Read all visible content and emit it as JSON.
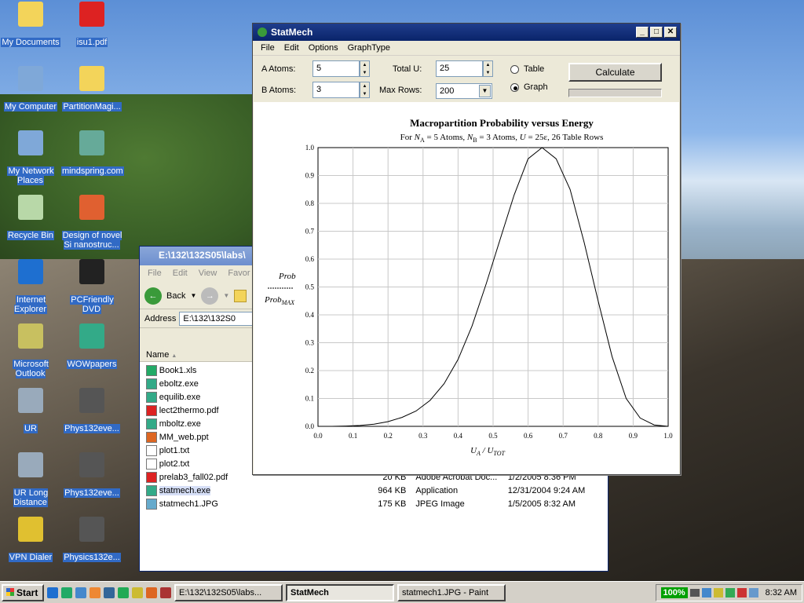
{
  "desktop": {
    "icons": [
      {
        "label": "My Documents",
        "icon": "folder-icon",
        "color": "#f3d45a"
      },
      {
        "label": "isu1.pdf",
        "icon": "pdf-icon",
        "color": "#d22"
      },
      {
        "label": "My Computer",
        "icon": "computer-icon",
        "color": "#7fa8d8"
      },
      {
        "label": "PartitionMagi...",
        "icon": "folder-zip-icon",
        "color": "#f3d45a"
      },
      {
        "label": "My Network Places",
        "icon": "network-icon",
        "color": "#7fa8d8"
      },
      {
        "label": "mindspring.com",
        "icon": "network-shortcut-icon",
        "color": "#6a9"
      },
      {
        "label": "Recycle Bin",
        "icon": "recycle-bin-icon",
        "color": "#b8d8a8"
      },
      {
        "label": "Design of novel Si nanostruc...",
        "icon": "powerpoint-icon",
        "color": "#e06030"
      },
      {
        "label": "Internet Explorer",
        "icon": "ie-icon",
        "color": "#1e6fd0"
      },
      {
        "label": "PCFriendly DVD",
        "icon": "dvd-icon",
        "color": "#222"
      },
      {
        "label": "Microsoft Outlook",
        "icon": "outlook-icon",
        "color": "#c8c060"
      },
      {
        "label": "WOWpapers",
        "icon": "wowpapers-icon",
        "color": "#3a8"
      },
      {
        "label": "UR",
        "icon": "network-drive-icon",
        "color": "#9ab"
      },
      {
        "label": "Phys132eve...",
        "icon": "document-icon",
        "color": "#555"
      },
      {
        "label": "UR Long Distance",
        "icon": "network-drive-icon",
        "color": "#9ab"
      },
      {
        "label": "Phys132eve...",
        "icon": "document-icon",
        "color": "#555"
      },
      {
        "label": "VPN Dialer",
        "icon": "vpn-icon",
        "color": "#e0c030"
      },
      {
        "label": "Physics132e...",
        "icon": "document-icon",
        "color": "#555"
      }
    ]
  },
  "explorer": {
    "title": "E:\\132\\132S05\\labs\\",
    "menu": [
      "File",
      "Edit",
      "View",
      "Favor"
    ],
    "back_label": "Back",
    "address_label": "Address",
    "address_value": "E:\\132\\132S0",
    "column_name": "Name",
    "files": [
      {
        "name": "Book1.xls",
        "size": "",
        "type": "",
        "date": ""
      },
      {
        "name": "eboltz.exe",
        "size": "",
        "type": "",
        "date": ""
      },
      {
        "name": "equilib.exe",
        "size": "",
        "type": "",
        "date": ""
      },
      {
        "name": "lect2thermo.pdf",
        "size": "",
        "type": "",
        "date": ""
      },
      {
        "name": "mboltz.exe",
        "size": "",
        "type": "",
        "date": ""
      },
      {
        "name": "MM_web.ppt",
        "size": "",
        "type": "",
        "date": ""
      },
      {
        "name": "plot1.txt",
        "size": "",
        "type": "",
        "date": ""
      },
      {
        "name": "plot2.txt",
        "size": "",
        "type": "",
        "date": ""
      },
      {
        "name": "prelab3_fall02.pdf",
        "size": "20 KB",
        "type": "Adobe Acrobat Doc...",
        "date": "1/2/2005 8:36 PM"
      },
      {
        "name": "statmech.exe",
        "size": "964 KB",
        "type": "Application",
        "date": "12/31/2004 9:24 AM"
      },
      {
        "name": "statmech1.JPG",
        "size": "175 KB",
        "type": "JPEG Image",
        "date": "1/5/2005 8:32 AM"
      }
    ]
  },
  "statmech": {
    "title": "StatMech",
    "menu": [
      "File",
      "Edit",
      "Options",
      "GraphType"
    ],
    "a_atoms_label": "A Atoms:",
    "a_atoms_value": "5",
    "b_atoms_label": "B Atoms:",
    "b_atoms_value": "3",
    "total_u_label": "Total U:",
    "total_u_value": "25",
    "max_rows_label": "Max Rows:",
    "max_rows_value": "200",
    "table_label": "Table",
    "graph_label": "Graph",
    "selected_mode": "graph",
    "calculate_label": "Calculate"
  },
  "chart_data": {
    "type": "line",
    "title": "Macropartition Probability versus Energy",
    "subtitle": "For N_A = 5 Atoms, N_B = 3 Atoms, U = 25ε, 26 Table Rows",
    "subtitle_parts": {
      "for": "For",
      "na": "N",
      "na_sub": "A",
      "na_rest": " = 5 Atoms, ",
      "nb": "N",
      "nb_sub": "B",
      "nb_rest": " = 3 Atoms, ",
      "u": "U",
      "u_rest": " = 25ε, 26 Table Rows"
    },
    "ylabel_top": "Prob",
    "ylabel_bottom": "Prob",
    "ylabel_bottom_sub": "MAX",
    "xlabel": "U",
    "xlabel_sub": "A",
    "xlabel_mid": " / U",
    "xlabel_sub2": "TOT",
    "xlim": [
      0,
      1
    ],
    "ylim": [
      0,
      1
    ],
    "xticks": [
      "0.0",
      "0.1",
      "0.2",
      "0.3",
      "0.4",
      "0.5",
      "0.6",
      "0.7",
      "0.8",
      "0.9",
      "1.0"
    ],
    "yticks": [
      "0.0",
      "0.1",
      "0.2",
      "0.3",
      "0.4",
      "0.5",
      "0.6",
      "0.7",
      "0.8",
      "0.9",
      "1.0"
    ],
    "grid": true,
    "x": [
      0,
      0.04,
      0.08,
      0.12,
      0.16,
      0.2,
      0.24,
      0.28,
      0.32,
      0.36,
      0.4,
      0.44,
      0.48,
      0.52,
      0.56,
      0.6,
      0.64,
      0.68,
      0.72,
      0.76,
      0.8,
      0.84,
      0.88,
      0.92,
      0.96,
      1.0
    ],
    "y": [
      0,
      0,
      0.001,
      0.003,
      0.008,
      0.017,
      0.032,
      0.055,
      0.093,
      0.153,
      0.24,
      0.36,
      0.51,
      0.67,
      0.83,
      0.96,
      1.0,
      0.96,
      0.85,
      0.66,
      0.45,
      0.25,
      0.1,
      0.03,
      0.005,
      0
    ]
  },
  "taskbar": {
    "start_label": "Start",
    "tasks": [
      "E:\\132\\132S05\\labs...",
      "StatMech",
      "statmech1.JPG - Paint"
    ],
    "zoom": "100%",
    "clock": "8:32 AM"
  }
}
